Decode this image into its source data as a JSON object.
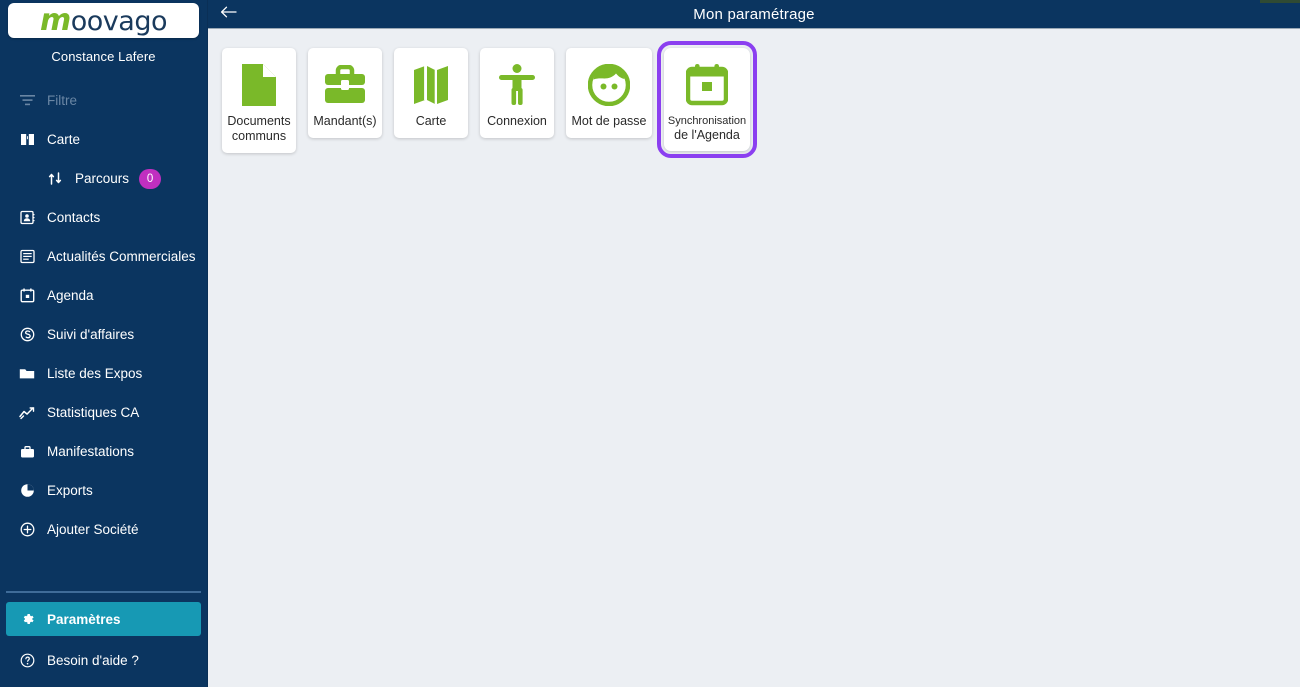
{
  "sidebar": {
    "logo": {
      "part1": "m",
      "part2": "oovago"
    },
    "username": "Constance Lafere",
    "items": [
      {
        "label": "Filtre",
        "icon": "filter-icon",
        "muted": true
      },
      {
        "label": "Carte",
        "icon": "map-book-icon",
        "muted": false
      },
      {
        "label": "Parcours",
        "icon": "route-icon",
        "badge": "0",
        "sub": true
      },
      {
        "label": "Contacts",
        "icon": "contacts-icon",
        "muted": false
      },
      {
        "label": "Actualités Commerciales",
        "icon": "news-list-icon",
        "muted": false
      },
      {
        "label": "Agenda",
        "icon": "calendar-icon",
        "muted": false
      },
      {
        "label": "Suivi d'affaires",
        "icon": "business-s-icon",
        "muted": false
      },
      {
        "label": "Liste des Expos",
        "icon": "folder-icon",
        "muted": false
      },
      {
        "label": "Statistiques CA",
        "icon": "chart-line-icon",
        "muted": false
      },
      {
        "label": "Manifestations",
        "icon": "briefcase-icon",
        "muted": false
      },
      {
        "label": "Exports",
        "icon": "pie-chart-icon",
        "muted": false
      },
      {
        "label": "Ajouter Société",
        "icon": "plus-circle-icon",
        "muted": false
      }
    ],
    "settings": {
      "label": "Paramètres",
      "icon": "gear-icon"
    },
    "help": {
      "label": "Besoin d'aide ?",
      "icon": "question-circle-icon"
    }
  },
  "header": {
    "back_icon": "arrow-left-icon",
    "title": "Mon paramétrage"
  },
  "cards": [
    {
      "line1": "Documents",
      "line2": "communs",
      "icon": "document-icon"
    },
    {
      "line1": "Mandant(s)",
      "line2": "",
      "icon": "briefcase-icon"
    },
    {
      "line1": "Carte",
      "line2": "",
      "icon": "map-icon"
    },
    {
      "line1": "Connexion",
      "line2": "",
      "icon": "accessibility-icon"
    },
    {
      "line1": "Mot de passe",
      "line2": "",
      "icon": "face-icon"
    },
    {
      "line1": "Synchronisation",
      "line2": "de l'Agenda",
      "icon": "calendar-sync-icon",
      "selected": true
    }
  ],
  "colors": {
    "sidebar_bg": "#0b3560",
    "accent_green": "#7ab929",
    "active_teal": "#1799b4",
    "badge_magenta": "#c02fc0",
    "selection_purple": "#8b3ff0",
    "content_bg": "#eceff3"
  }
}
